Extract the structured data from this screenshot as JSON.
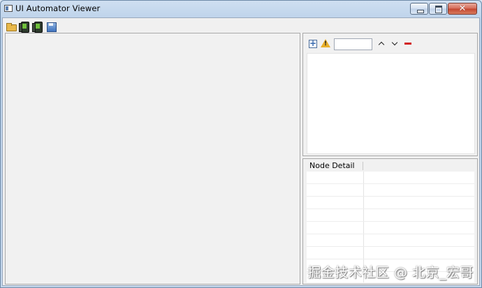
{
  "window": {
    "title": "UI Automator Viewer",
    "controls": {
      "minimize_icon": "minimize-icon",
      "maximize_icon": "maximize-icon",
      "close_glyph": "✕"
    }
  },
  "toolbar": {
    "items": [
      {
        "icon": "open-folder-icon"
      },
      {
        "icon": "device-screenshot-icon"
      },
      {
        "icon": "device-screenshot-compressed-icon"
      },
      {
        "icon": "save-icon"
      }
    ]
  },
  "tree_panel": {
    "toolbar": {
      "expand_icon": "expand-all-icon",
      "warning_icon": "warning-icon",
      "search_value": "",
      "prev_icon": "chevron-up-icon",
      "next_icon": "chevron-down-icon",
      "toggle_icon": "toggle-naf-icon"
    }
  },
  "node_detail": {
    "header": "Node Detail",
    "rows": []
  },
  "watermark": "掘金技术社区 @ 北京_宏哥",
  "colors": {
    "titlebar": "#c4d7ec",
    "close_button": "#c2452f",
    "panel_bg": "#f1f1f1",
    "warning": "#e9b02a",
    "remove_red": "#d21f1f"
  }
}
